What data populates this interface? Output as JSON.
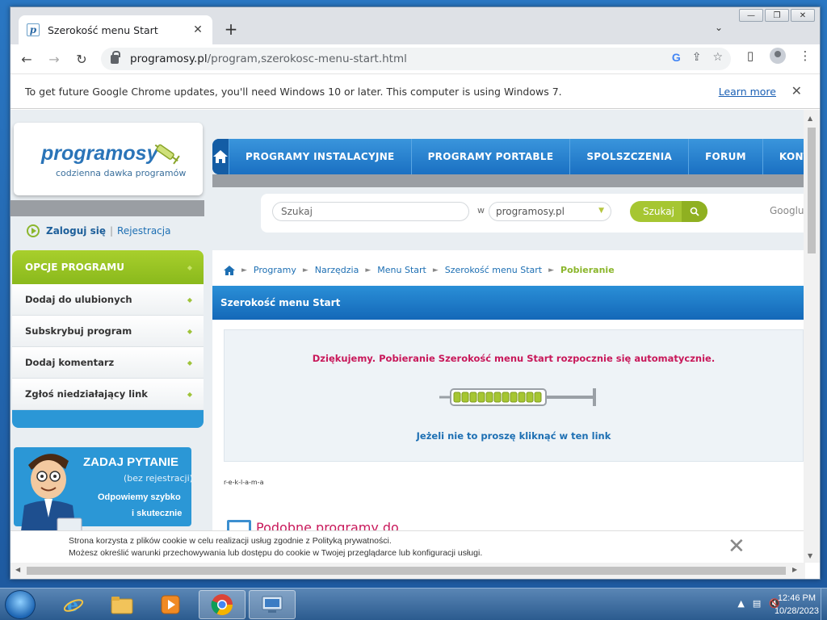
{
  "browser": {
    "tab_title": "Szerokość menu Start",
    "tab_favicon": "p",
    "new_tab_label": "+",
    "url_host": "programosy.pl",
    "url_path": "/program,szerokosc-menu-start.html",
    "infobar_text": "To get future Google Chrome updates, you'll need Windows 10 or later. This computer is using Windows 7.",
    "learn_more": "Learn more"
  },
  "site": {
    "logo_word": "programosy",
    "logo_tagline": "codzienna dawka programów",
    "nav": [
      "PROGRAMY INSTALACYJNE",
      "PROGRAMY PORTABLE",
      "SPOLSZCZENIA",
      "FORUM",
      "KONTAKT"
    ],
    "search_placeholder": "Szukaj",
    "search_in": "w",
    "search_scope": "programosy.pl",
    "search_button": "Szukaj",
    "google_label": "Googluj",
    "login": "Zaloguj się",
    "login_sep": "|",
    "register": "Rejestracja"
  },
  "sidebar": {
    "header": "OPCJE PROGRAMU",
    "items": [
      "Dodaj do ulubionych",
      "Subskrybuj program",
      "Dodaj komentarz",
      "Zgłoś niedziałający link"
    ]
  },
  "ask": {
    "title": "ZADAJ PYTANIE",
    "subtitle": "(bez rejestracji)",
    "line1": "Odpowiemy szybko",
    "line2": "i skutecznie"
  },
  "content": {
    "breadcrumbs": [
      "Programy",
      "Narzędzia",
      "Menu Start",
      "Szerokość menu Start"
    ],
    "breadcrumb_current": "Pobieranie",
    "title": "Szerokość menu Start",
    "thanks": "Dziękujemy. Pobieranie Szerokość menu Start rozpocznie się automatycznie.",
    "manual_link": "Jeżeli nie to proszę kliknąć w ten link",
    "ad_label": "r-e-k-l-a-m-a",
    "similar_title": "Podobne programy do"
  },
  "cookie": {
    "line1": "Strona korzysta z plików cookie w celu realizacji usług zgodnie z Polityką prywatności.",
    "line2": "Możesz określić warunki przechowywania lub dostępu do cookie w Twojej przeglądarce lub konfiguracji usługi."
  },
  "taskbar": {
    "time": "12:46 PM",
    "date": "10/28/2023",
    "apps": [
      "internet-explorer",
      "file-explorer",
      "media-player",
      "chrome",
      "remote-desktop"
    ]
  },
  "colors": {
    "brand_blue": "#2a74b8",
    "brand_green": "#8bb62c",
    "accent_pink": "#c8185a"
  }
}
